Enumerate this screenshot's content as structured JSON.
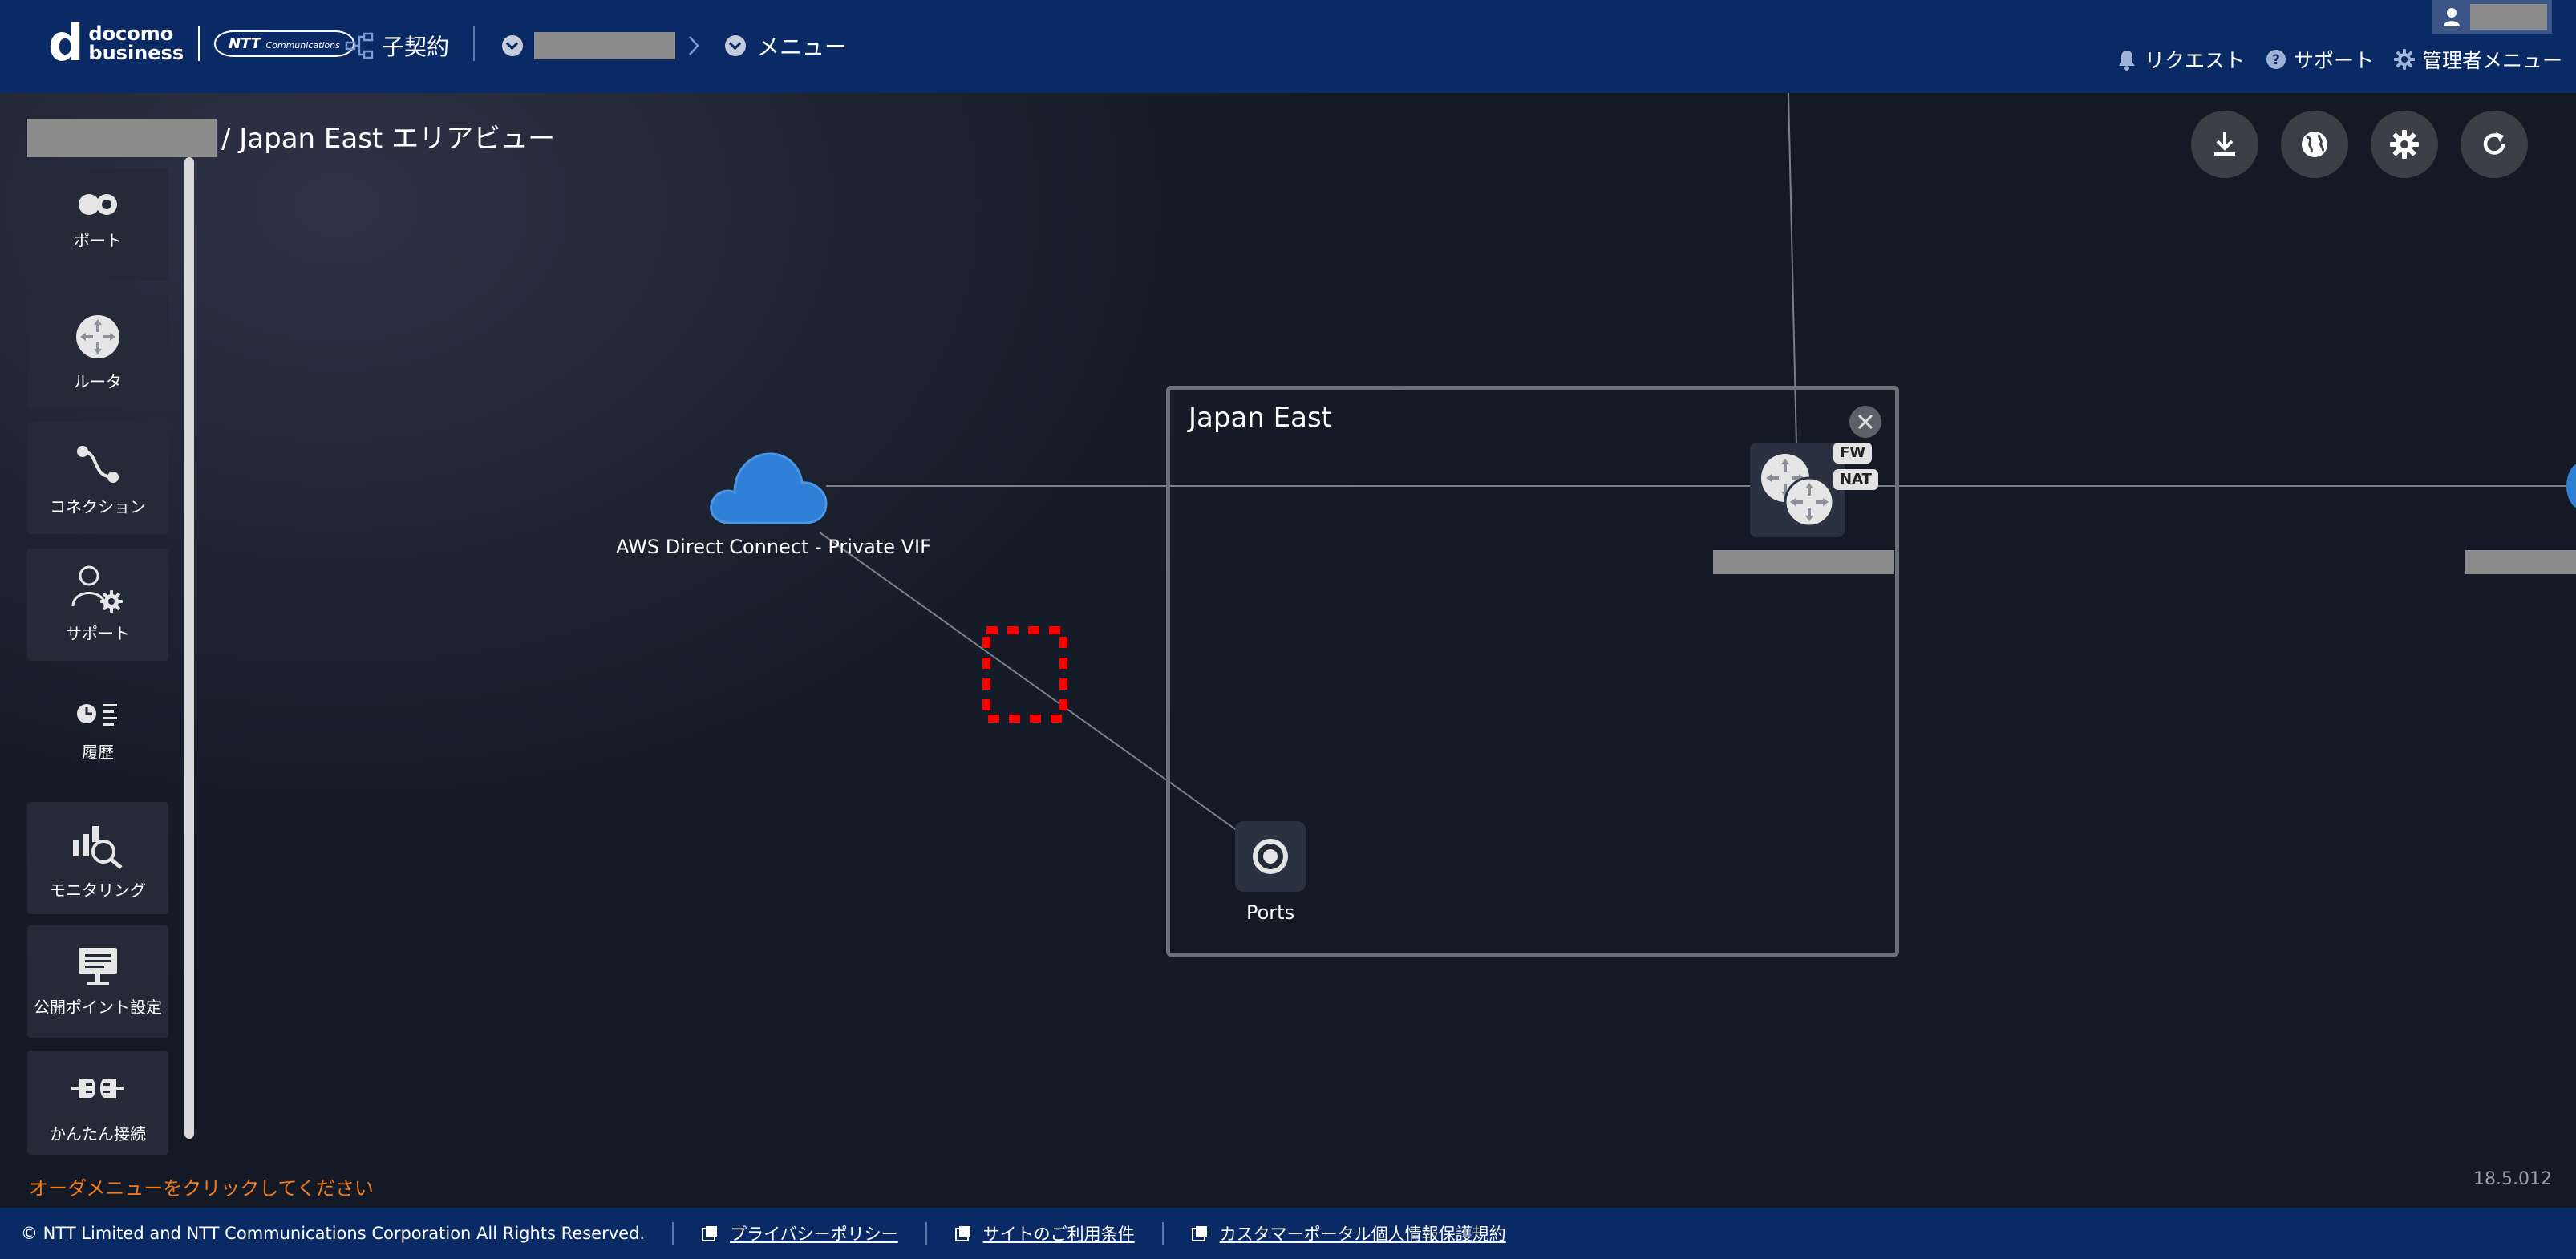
{
  "header": {
    "logo": {
      "line1": "docomo",
      "line2": "business",
      "ntt": "NTT",
      "ntt_sub": "Communications"
    },
    "sub_contract": "子契約",
    "menu_label": "メニュー",
    "right_menu": [
      {
        "icon": "bell-icon",
        "label": "リクエスト"
      },
      {
        "icon": "question-circle-icon",
        "label": "サポート"
      },
      {
        "icon": "gear-icon",
        "label": "管理者メニュー"
      }
    ]
  },
  "page": {
    "title": "/ Japan East エリアビュー"
  },
  "sidebar": {
    "items": [
      {
        "label": "ポート",
        "icon": "port-icon"
      },
      {
        "label": "ルータ",
        "icon": "router-icon"
      },
      {
        "label": "コネクション",
        "icon": "connection-icon"
      },
      {
        "label": "サポート",
        "icon": "support-user-icon"
      },
      {
        "label": "履歴",
        "icon": "history-icon"
      },
      {
        "label": "モニタリング",
        "icon": "monitoring-icon"
      },
      {
        "label": "公開ポイント設定",
        "icon": "public-point-icon"
      },
      {
        "label": "かんたん接続",
        "icon": "easy-connect-icon"
      }
    ]
  },
  "toolbar": {
    "buttons": [
      "download-icon",
      "globe-icon",
      "settings-icon",
      "refresh-icon"
    ]
  },
  "diagram": {
    "area_title": "Japan East",
    "cloud_label": "AWS Direct Connect - Private VIF",
    "router_tags": [
      "FW",
      "NAT"
    ],
    "port_label": "Ports"
  },
  "status_message": "オーダメニューをクリックしてください",
  "version": "18.5.012",
  "footer": {
    "copyright": "© NTT Limited and NTT Communications Corporation All Rights Reserved.",
    "links": [
      "プライバシーポリシー",
      "サイトのご利用条件",
      "カスタマーポータル個人情報保護規約"
    ]
  },
  "colors": {
    "header_bg": "#0a2a66",
    "status_text": "#f07a1c",
    "highlight": "#ff0000",
    "cloud": "#2f7fd6"
  }
}
